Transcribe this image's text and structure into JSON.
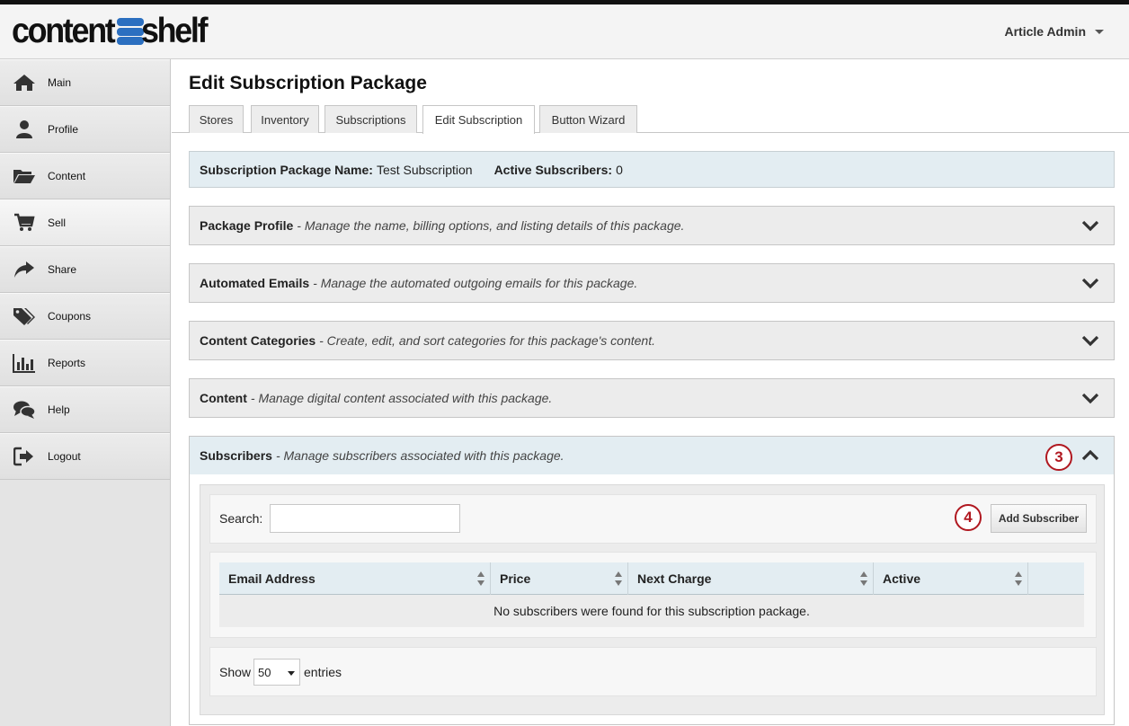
{
  "header": {
    "logo_left": "content",
    "logo_right": "shelf",
    "user_name": "Article Admin"
  },
  "sidebar": {
    "items": [
      {
        "label": "Main",
        "icon": "home-icon"
      },
      {
        "label": "Profile",
        "icon": "user-icon"
      },
      {
        "label": "Content",
        "icon": "folder-icon"
      },
      {
        "label": "Sell",
        "icon": "cart-icon"
      },
      {
        "label": "Share",
        "icon": "share-icon"
      },
      {
        "label": "Coupons",
        "icon": "tags-icon"
      },
      {
        "label": "Reports",
        "icon": "bar-chart-icon"
      },
      {
        "label": "Help",
        "icon": "chat-icon"
      },
      {
        "label": "Logout",
        "icon": "logout-icon"
      }
    ],
    "active": "Sell"
  },
  "page": {
    "title": "Edit Subscription Package"
  },
  "tabs": [
    {
      "label": "Stores"
    },
    {
      "label": "Inventory"
    },
    {
      "label": "Subscriptions"
    },
    {
      "label": "Edit Subscription"
    },
    {
      "label": "Button Wizard"
    }
  ],
  "active_tab": "Edit Subscription",
  "info": {
    "name_label": "Subscription Package Name:",
    "name_value": "Test Subscription",
    "subs_label": "Active Subscribers:",
    "subs_value": "0"
  },
  "panels": [
    {
      "title": "Package Profile",
      "desc": "- Manage the name, billing options, and listing details of this package."
    },
    {
      "title": "Automated Emails",
      "desc": "- Manage the automated outgoing emails for this package."
    },
    {
      "title": "Content Categories",
      "desc": "- Create, edit, and sort categories for this package's content."
    },
    {
      "title": "Content",
      "desc": "- Manage digital content associated with this package."
    },
    {
      "title": "Subscribers",
      "desc": "- Manage subscribers associated with this package."
    }
  ],
  "subscribers": {
    "step_badge_panel": "3",
    "step_badge_add": "4",
    "search_label": "Search:",
    "search_value": "",
    "add_button": "Add Subscriber",
    "columns": [
      "Email Address",
      "Price",
      "Next Charge",
      "Active",
      ""
    ],
    "empty_message": "No subscribers were found for this subscription package.",
    "show_label": "Show",
    "page_length": "50",
    "entries_label": "entries"
  },
  "colors": {
    "accent_blue": "#2b6fc0",
    "header_band": "#e3edf2",
    "badge_red": "#b01820"
  }
}
